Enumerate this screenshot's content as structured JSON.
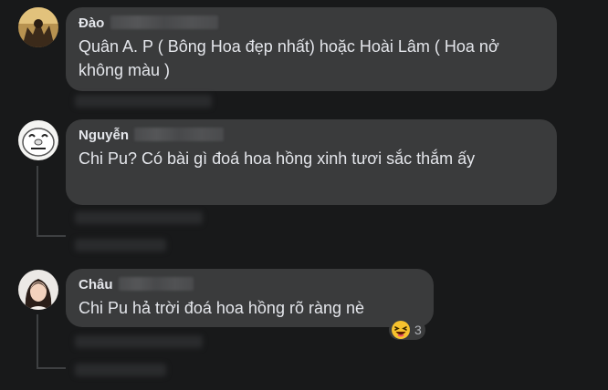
{
  "comments": [
    {
      "author": "Đào",
      "text": "Quân A. P ( Bông Hoa đẹp nhất) hoặc Hoài Lâm ( Hoa nở không màu )",
      "avatar_icon": "profile-photo-icon"
    },
    {
      "author": "Nguyễn",
      "text": "Chi Pu? Có bài gì đoá hoa hồng xinh tươi sắc thắm ấy",
      "avatar_icon": "cartoon-face-avatar-icon"
    },
    {
      "author": "Châu",
      "text": "Chi Pu hả trời đoá hoa hồng rõ ràng nè",
      "avatar_icon": "profile-photo-icon",
      "reaction": {
        "emoji": "😆",
        "icon": "haha-reaction-icon",
        "count": "3"
      }
    }
  ],
  "colors": {
    "background": "#18191a",
    "bubble": "#3a3b3c",
    "text": "#e4e6eb",
    "muted": "#b0b3b8",
    "thread_line": "#3e4042"
  }
}
